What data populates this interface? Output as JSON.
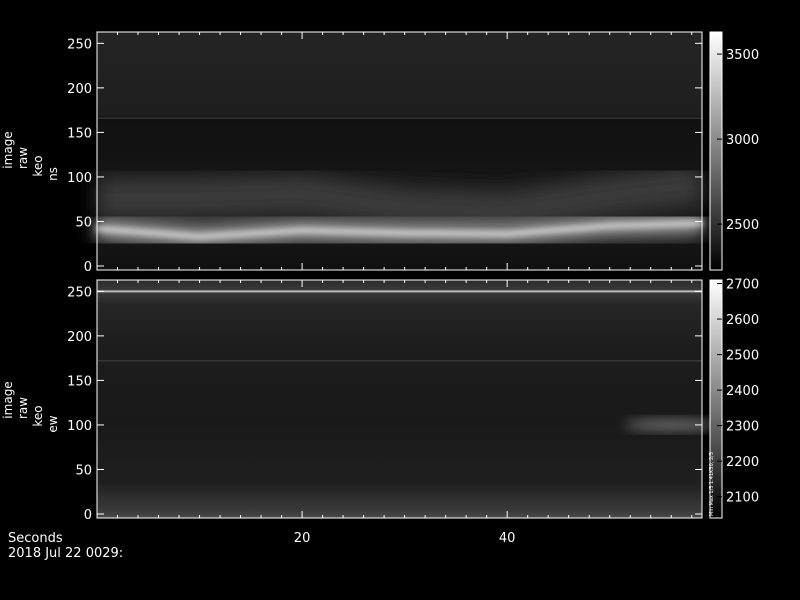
{
  "footer": {
    "x_unit": "Seconds",
    "timestamp": "2018 Jul 22 0029:"
  },
  "chart_data": [
    {
      "type": "heatmap",
      "ylabel": [
        "image",
        "raw",
        "keo",
        "ns"
      ],
      "xlim": [
        0,
        59
      ],
      "ylim": [
        0,
        256
      ],
      "x_ticks": [
        20,
        40
      ],
      "y_ticks": [
        0,
        50,
        100,
        150,
        200,
        250
      ],
      "colorbar": {
        "range": [
          2230,
          3630
        ],
        "ticks": [
          2500,
          3000,
          3500
        ]
      },
      "colormap": "grayscale",
      "horizontal_line_y": 166,
      "bright_band": [
        {
          "x": 0,
          "y": 42
        },
        {
          "x": 10,
          "y": 33
        },
        {
          "x": 20,
          "y": 40
        },
        {
          "x": 30,
          "y": 37
        },
        {
          "x": 40,
          "y": 36
        },
        {
          "x": 50,
          "y": 45
        },
        {
          "x": 59,
          "y": 48
        }
      ]
    },
    {
      "type": "heatmap",
      "ylabel": [
        "image",
        "raw",
        "keo",
        "ew"
      ],
      "xlim": [
        0,
        59
      ],
      "ylim": [
        0,
        256
      ],
      "x_ticks": [
        20,
        40
      ],
      "x_tick_labels": [
        "20",
        "40"
      ],
      "y_ticks": [
        0,
        50,
        100,
        150,
        200,
        250
      ],
      "colorbar": {
        "range": [
          2040,
          2710
        ],
        "ticks": [
          2100,
          2200,
          2300,
          2400,
          2500,
          2600,
          2700
        ]
      },
      "colormap": "grayscale",
      "horizontal_lines_y": [
        172,
        250
      ],
      "bright_feature": {
        "x": [
          50,
          59
        ],
        "y": 100
      },
      "annotation": "Min Max 1/5 1.41K50, 2/5"
    }
  ]
}
